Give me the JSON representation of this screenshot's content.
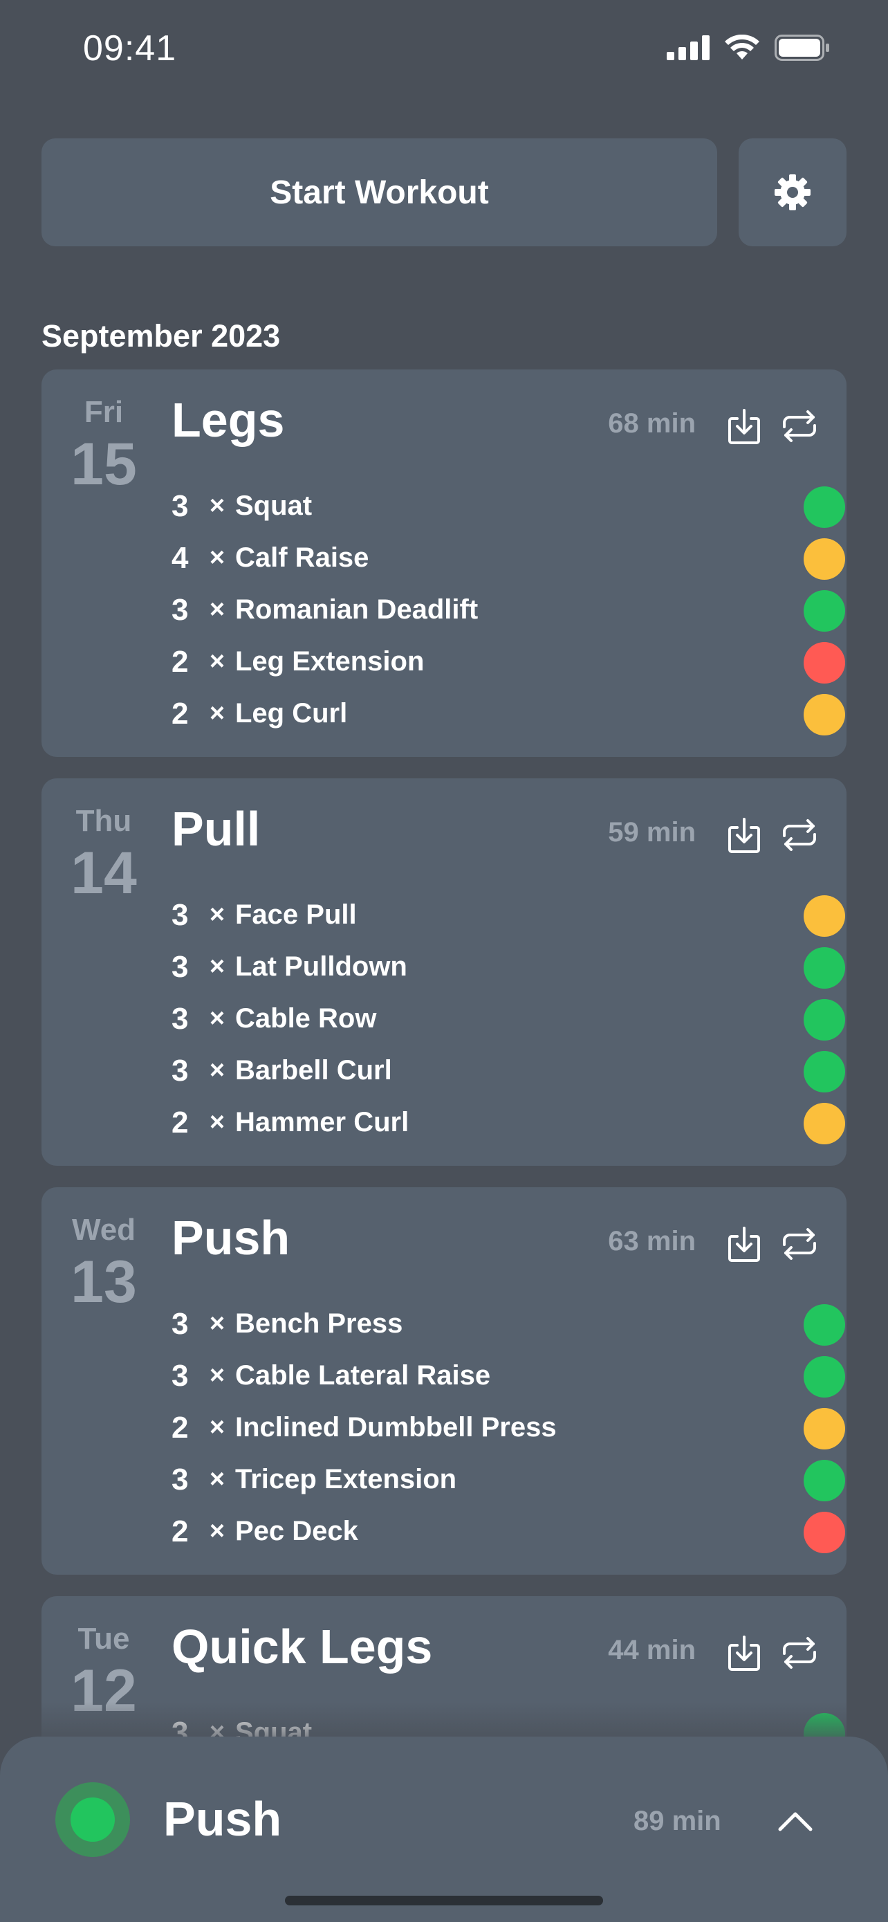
{
  "status_bar": {
    "time": "09:41"
  },
  "top_actions": {
    "start_workout_label": "Start Workout"
  },
  "section": {
    "month": "September 2023"
  },
  "workouts": [
    {
      "dow": "Fri",
      "day": "15",
      "title": "Legs",
      "duration": "68 min",
      "exercises": [
        {
          "sets": "3",
          "times": "×",
          "name": "Squat",
          "status": "green"
        },
        {
          "sets": "4",
          "times": "×",
          "name": "Calf Raise",
          "status": "orange"
        },
        {
          "sets": "3",
          "times": "×",
          "name": "Romanian Deadlift",
          "status": "green"
        },
        {
          "sets": "2",
          "times": "×",
          "name": "Leg Extension",
          "status": "red"
        },
        {
          "sets": "2",
          "times": "×",
          "name": "Leg Curl",
          "status": "orange"
        }
      ]
    },
    {
      "dow": "Thu",
      "day": "14",
      "title": "Pull",
      "duration": "59 min",
      "exercises": [
        {
          "sets": "3",
          "times": "×",
          "name": "Face Pull",
          "status": "orange"
        },
        {
          "sets": "3",
          "times": "×",
          "name": "Lat Pulldown",
          "status": "green"
        },
        {
          "sets": "3",
          "times": "×",
          "name": "Cable Row",
          "status": "green"
        },
        {
          "sets": "3",
          "times": "×",
          "name": "Barbell Curl",
          "status": "green"
        },
        {
          "sets": "2",
          "times": "×",
          "name": "Hammer Curl",
          "status": "orange"
        }
      ]
    },
    {
      "dow": "Wed",
      "day": "13",
      "title": "Push",
      "duration": "63 min",
      "exercises": [
        {
          "sets": "3",
          "times": "×",
          "name": "Bench Press",
          "status": "green"
        },
        {
          "sets": "3",
          "times": "×",
          "name": "Cable Lateral Raise",
          "status": "green"
        },
        {
          "sets": "2",
          "times": "×",
          "name": "Inclined Dumbbell Press",
          "status": "orange"
        },
        {
          "sets": "3",
          "times": "×",
          "name": "Tricep Extension",
          "status": "green"
        },
        {
          "sets": "2",
          "times": "×",
          "name": "Pec Deck",
          "status": "red"
        }
      ]
    },
    {
      "dow": "Tue",
      "day": "12",
      "title": "Quick Legs",
      "duration": "44 min",
      "exercises": [
        {
          "sets": "3",
          "times": "×",
          "name": "Squat",
          "status": "green"
        }
      ]
    }
  ],
  "active_workout": {
    "title": "Push",
    "duration": "89 min",
    "indicator_color": "#22c55e"
  },
  "colors": {
    "green": "#22c55e",
    "orange": "#fbbf3c",
    "red": "#ff5a54",
    "card": "#56616e",
    "background": "#4a5059"
  },
  "icons": [
    "signal-icon",
    "wifi-icon",
    "battery-icon",
    "gear-icon",
    "export-icon",
    "repeat-icon",
    "chevron-up-icon"
  ]
}
